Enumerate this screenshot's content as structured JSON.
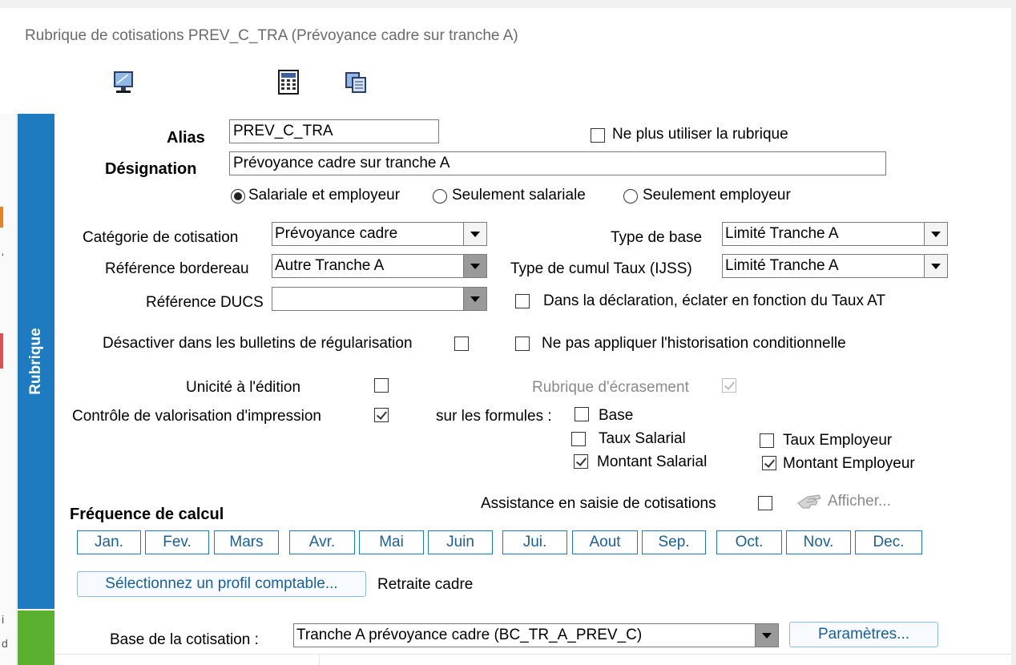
{
  "window": {
    "title": "Rubrique de cotisations PREV_C_TRA (Prévoyance cadre sur tranche A)"
  },
  "sidebar": {
    "section_label": "Rubrique"
  },
  "toolbar": {
    "icons": [
      "monitor-icon",
      "calculator-icon",
      "window-copy-icon"
    ]
  },
  "form": {
    "alias_label": "Alias",
    "alias_value": "PREV_C_TRA",
    "ne_plus_utiliser": {
      "label": "Ne plus utiliser la rubrique",
      "checked": false
    },
    "designation_label": "Désignation",
    "designation_value": "Prévoyance cadre sur tranche A",
    "radio_options": [
      {
        "label": "Salariale et employeur",
        "selected": true
      },
      {
        "label": "Seulement salariale",
        "selected": false
      },
      {
        "label": "Seulement employeur",
        "selected": false
      }
    ],
    "categorie_label": "Catégorie de cotisation",
    "categorie_value": "Prévoyance cadre",
    "reference_bordereau_label": "Référence bordereau",
    "reference_bordereau_value": "Autre Tranche A",
    "reference_ducs_label": "Référence DUCS",
    "reference_ducs_value": "",
    "type_base_label": "Type de base",
    "type_base_value": "Limité Tranche A",
    "type_cumul_label": "Type de cumul Taux (IJSS)",
    "type_cumul_value": "Limité Tranche A",
    "eclater_taux_at": {
      "label": "Dans la déclaration, éclater en fonction du Taux AT",
      "checked": false
    },
    "desactiver_regularisation": {
      "label": "Désactiver dans les bulletins de régularisation",
      "checked": false
    },
    "historisation": {
      "label": "Ne pas appliquer l'historisation conditionnelle",
      "checked": false
    },
    "unicite": {
      "label": "Unicité à l'édition",
      "checked": false
    },
    "controle_valorisation": {
      "label": "Contrôle de valorisation d'impression",
      "checked": true
    },
    "rubrique_ecrasement": {
      "label": "Rubrique d'écrasement",
      "checked": true,
      "enabled": false
    },
    "sur_les_formules_label": "sur les formules :",
    "formules": {
      "base": {
        "label": "Base",
        "checked": false
      },
      "taux_salarial": {
        "label": "Taux Salarial",
        "checked": false
      },
      "taux_employeur": {
        "label": "Taux Employeur",
        "checked": false
      },
      "montant_salarial": {
        "label": "Montant Salarial",
        "checked": true
      },
      "montant_employeur": {
        "label": "Montant Employeur",
        "checked": true
      }
    },
    "assistance": {
      "label": "Assistance en saisie de cotisations",
      "checked": false
    },
    "afficher_label": "Afficher..."
  },
  "frequence": {
    "title": "Fréquence de calcul",
    "months": [
      "Jan.",
      "Fev.",
      "Mars",
      "Avr.",
      "Mai",
      "Juin",
      "Jui.",
      "Aout",
      "Sep.",
      "Oct.",
      "Nov.",
      "Dec."
    ]
  },
  "profil": {
    "button_label": "Sélectionnez un profil comptable...",
    "value": "Retraite cadre"
  },
  "base_cotisation": {
    "label": "Base de la cotisation :",
    "value": "Tranche A prévoyance cadre (BC_TR_A_PREV_C)",
    "parametres_label": "Paramètres..."
  },
  "edge_text": {
    "char1": "'",
    "char2": "i",
    "char3": "d"
  }
}
